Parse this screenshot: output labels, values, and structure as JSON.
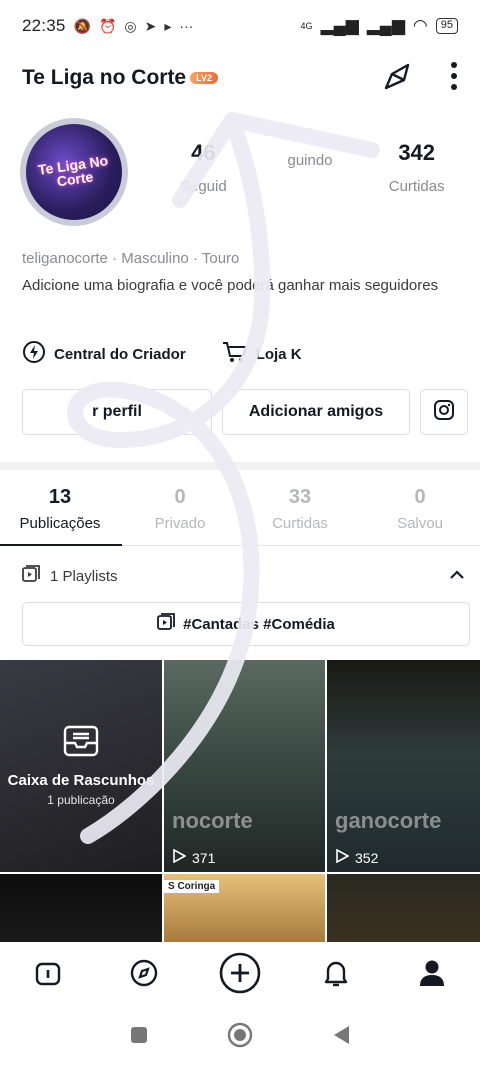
{
  "status_bar": {
    "time": "22:35",
    "network": "4G",
    "battery": "95"
  },
  "header": {
    "username": "Te Liga no Corte",
    "level_badge": "LV2"
  },
  "avatar": {
    "text": "Te Liga No Corte"
  },
  "stats": [
    {
      "value": "46",
      "label": "Seguid"
    },
    {
      "value": "",
      "label": "guindo"
    },
    {
      "value": "342",
      "label": "Curtidas"
    }
  ],
  "meta": {
    "handle": "teliganocorte",
    "gender": "Masculino",
    "sign": "Touro"
  },
  "bio": "Adicione uma biografia e você poderá ganhar mais seguidores",
  "tools": {
    "creator_center": "Central do Criador",
    "shop": "Loja K"
  },
  "buttons": {
    "edit_profile": "r perfil",
    "add_friends": "Adicionar amigos"
  },
  "tabs": [
    {
      "count": "13",
      "label": "Publicações"
    },
    {
      "count": "0",
      "label": "Privado"
    },
    {
      "count": "33",
      "label": "Curtidas"
    },
    {
      "count": "0",
      "label": "Salvou"
    }
  ],
  "playlists": {
    "label": "1 Playlists",
    "chip": "#Cantadas #Comédia"
  },
  "grid": {
    "drafts_title": "Caixa de Rascunhos",
    "drafts_sub": "1 publicação",
    "video1_watermark": "nocorte",
    "video1_views": "371",
    "video2_watermark": "ganocorte",
    "video2_views": "352",
    "video4_tag": "S Coringa"
  }
}
